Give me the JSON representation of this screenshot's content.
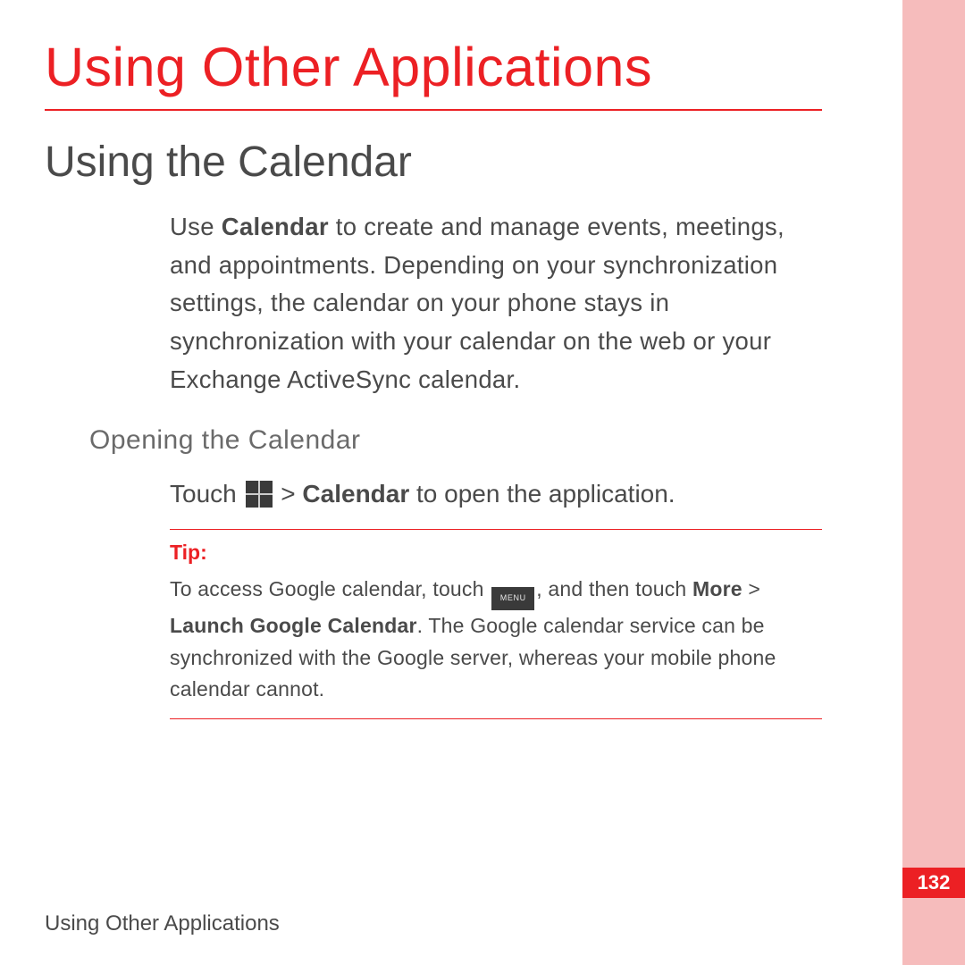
{
  "chapter": {
    "title": "Using Other Applications"
  },
  "section": {
    "title": "Using the Calendar"
  },
  "intro": {
    "prefix": "Use ",
    "bold1": "Calendar",
    "rest": " to create and manage events, meetings, and appointments. Depending on your synchronization settings, the calendar on your phone stays in synchronization with your calendar on the web or your Exchange ActiveSync calendar."
  },
  "subsection": {
    "title": "Opening  the Calendar"
  },
  "instruction": {
    "prefix": "Touch ",
    "gt": " > ",
    "bold": "Calendar",
    "suffix": " to open the application."
  },
  "tip": {
    "label": "Tip:",
    "t1": "To access Google calendar,  touch ",
    "t2": ", and then touch ",
    "b1": "More",
    "gt": " > ",
    "b2": "Launch Google Calendar",
    "t3": ". The Google calendar service can be synchronized with the Google server, whereas your mobile phone calendar cannot."
  },
  "menu_icon_label": "MENU",
  "footer": {
    "text": "Using Other Applications"
  },
  "page": {
    "number": "132"
  }
}
